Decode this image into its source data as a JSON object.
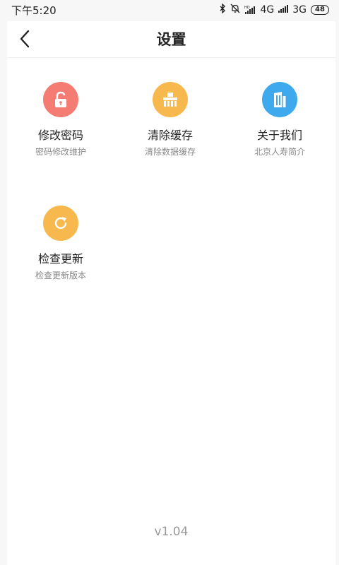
{
  "status_bar": {
    "time": "下午5:20",
    "network_1": "4G",
    "network_2": "3G",
    "battery": "48",
    "icons": [
      "bluetooth-icon",
      "mute-icon",
      "hd-icon",
      "signal-icon",
      "battery-icon"
    ]
  },
  "header": {
    "title": "设置",
    "back_icon": "chevron-left-icon"
  },
  "items": [
    {
      "title": "修改密码",
      "subtitle": "密码修改维护",
      "icon": "unlock-icon",
      "color": "#f57c72"
    },
    {
      "title": "清除缓存",
      "subtitle": "清除数据缓存",
      "icon": "brush-icon",
      "color": "#f7b84e"
    },
    {
      "title": "关于我们",
      "subtitle": "北京人寿简介",
      "icon": "building-icon",
      "color": "#3fa9ee"
    },
    {
      "title": "检查更新",
      "subtitle": "检查更新版本",
      "icon": "refresh-icon",
      "color": "#f7b84e"
    }
  ],
  "footer": {
    "version": "v1.04"
  }
}
